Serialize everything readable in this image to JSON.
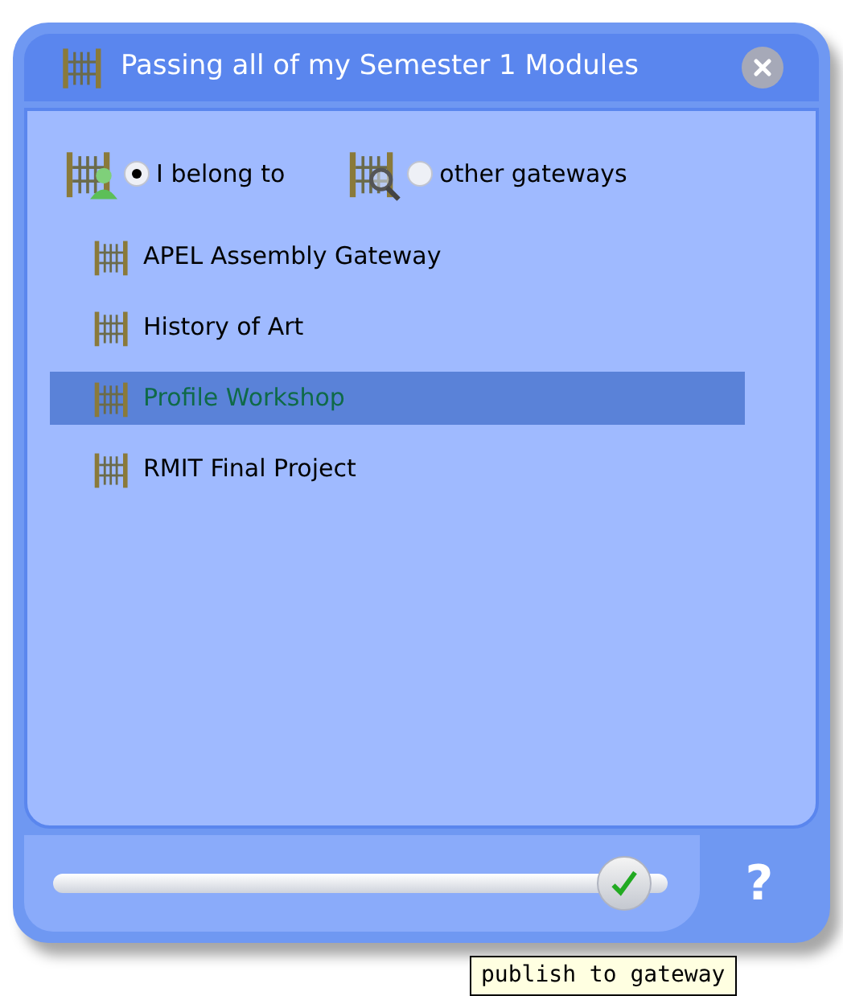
{
  "window": {
    "title": "Passing all of my Semester 1 Modules"
  },
  "filters": [
    {
      "label": "I belong to",
      "kind": "member",
      "selected": true
    },
    {
      "label": "other gateways",
      "kind": "search",
      "selected": false
    }
  ],
  "gateways": [
    {
      "name": "APEL Assembly Gateway",
      "selected": false
    },
    {
      "name": "History of Art",
      "selected": false
    },
    {
      "name": "Profile Workshop",
      "selected": true
    },
    {
      "name": "RMIT Final Project",
      "selected": false
    }
  ],
  "publish_slider": {
    "level": 0.93
  },
  "help": {
    "label": "?"
  },
  "tooltip": {
    "text": "publish to gateway"
  }
}
